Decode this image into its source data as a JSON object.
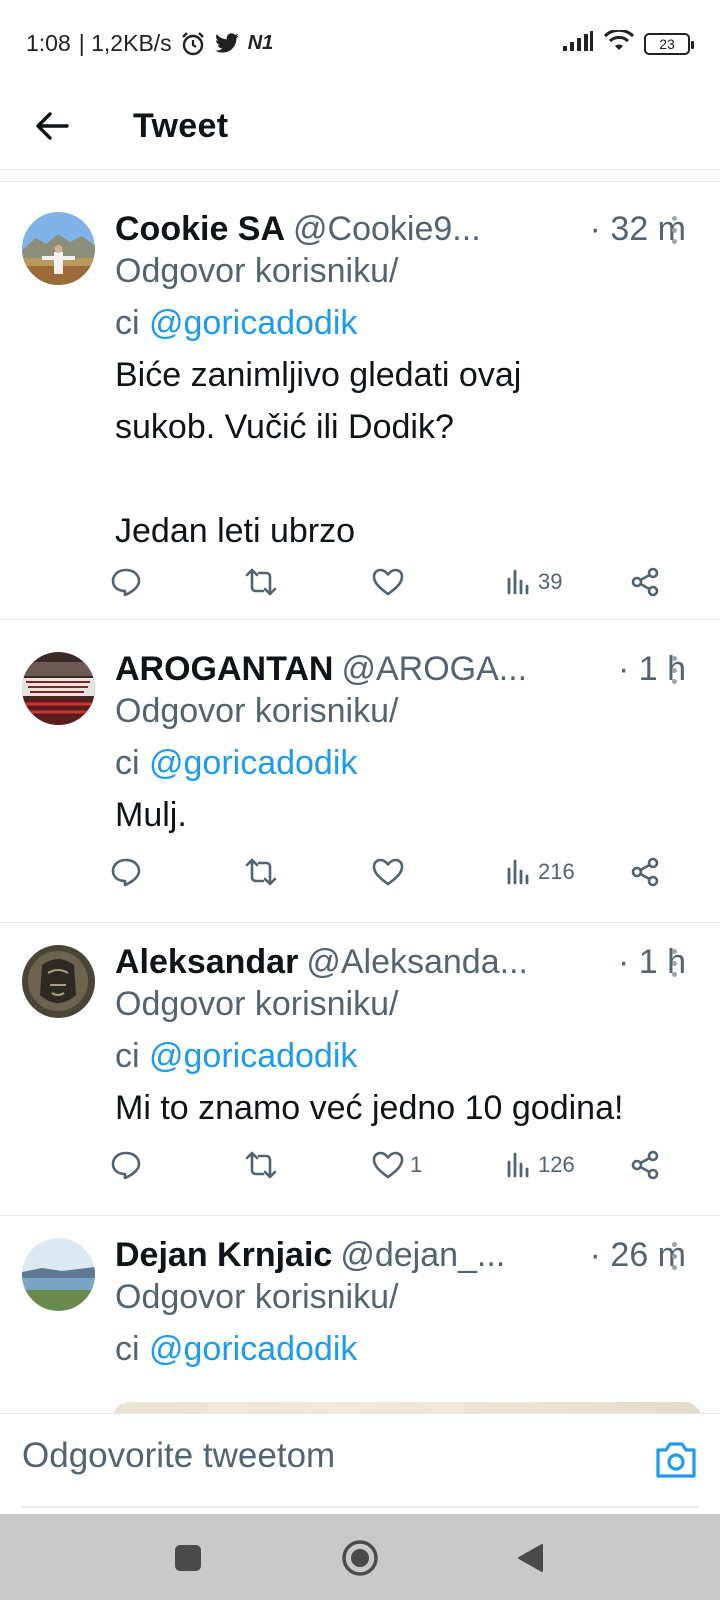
{
  "status_bar": {
    "time": "1:08",
    "speed": "| 1,2KB/s",
    "network_badge": "N1",
    "battery": "23"
  },
  "header": {
    "title": "Tweet"
  },
  "tweets": [
    {
      "name": "Cookie SA",
      "handle": "@Cookie9...",
      "time": "· 32 m",
      "reply_prefix": "Odgovor korisniku/",
      "reply_ci": "ci ",
      "mention": "@goricadodik",
      "text": "Biće zanimljivo gledati ovaj\nsukob. Vučić ili Dodik?\n\nJedan leti ubrzo",
      "likes": "",
      "views": "39"
    },
    {
      "name": "AROGANTAN",
      "handle": "@AROGA...",
      "time": "· 1 h",
      "reply_prefix": "Odgovor korisniku/",
      "reply_ci": "ci ",
      "mention": "@goricadodik",
      "text": "Mulj.",
      "likes": "",
      "views": "216"
    },
    {
      "name": "Aleksandar",
      "handle": "@Aleksanda...",
      "time": "· 1 h",
      "reply_prefix": "Odgovor korisniku/",
      "reply_ci": "ci ",
      "mention": "@goricadodik",
      "text": "Mi to znamo već jedno 10 godina!",
      "likes": "1",
      "views": "126"
    },
    {
      "name": "Dejan Krnjaic",
      "handle": "@dejan_...",
      "time": "· 26 m",
      "reply_prefix": "Odgovor korisniku/",
      "reply_ci": "ci ",
      "mention": "@goricadodik"
    }
  ],
  "composer": {
    "placeholder": "Odgovorite tweetom"
  },
  "colors": {
    "link": "#1d9bf0",
    "muted": "#536471",
    "text": "#0f1419"
  }
}
